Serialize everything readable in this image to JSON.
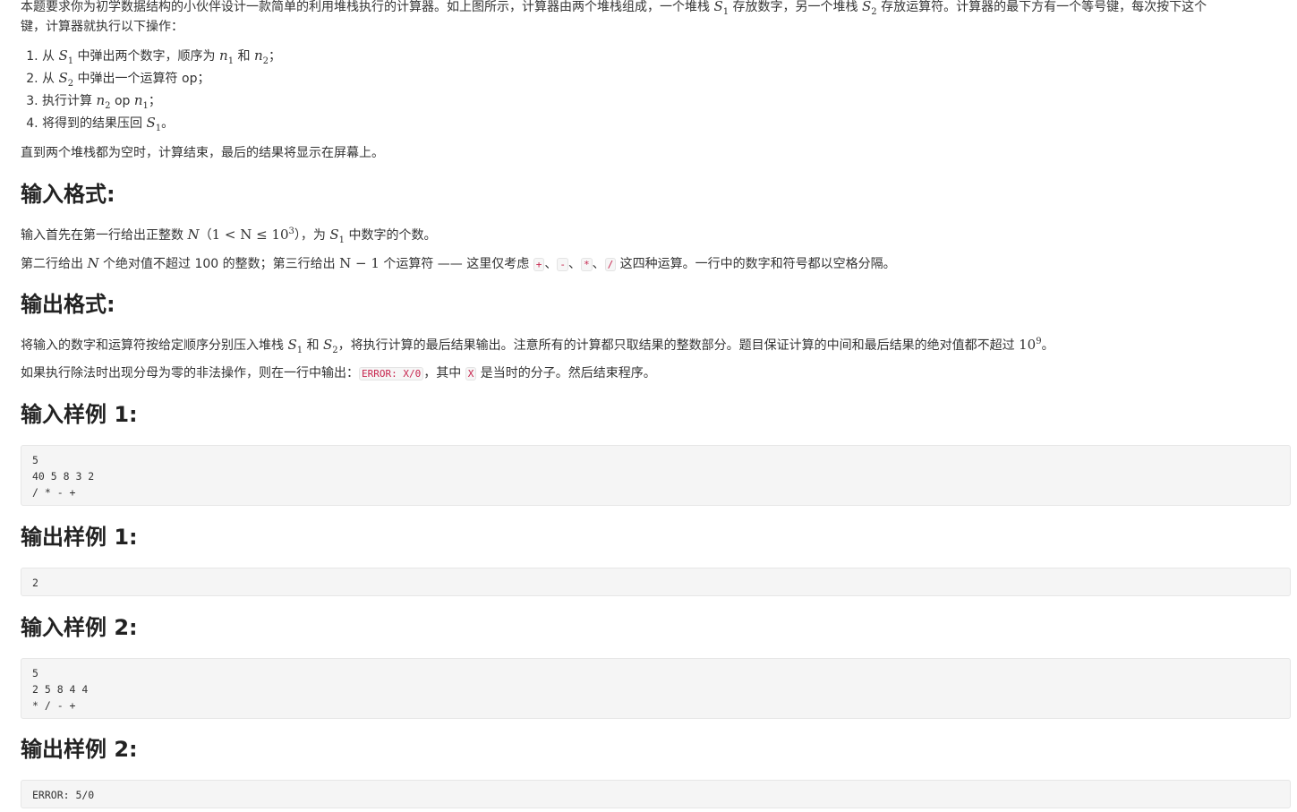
{
  "intro": {
    "p1_a": "本题要求你为初学数据结构的小伙伴设计一款简单的利用堆栈执行的计算器。如上图所示，计算器由两个堆栈组成，一个堆栈 ",
    "s": "S",
    "sub1": "1",
    "sub2": "2",
    "p1_b": " 存放数字，另一个堆栈 ",
    "p1_c": " 存放运算符。计算器的最下方有一个等号键，每次按下这个",
    "p1_d": "键，计算器就执行以下操作：",
    "steps": [
      {
        "a": "从 ",
        "b": " 中弹出两个数字，顺序为 ",
        "c": " 和 ",
        "d": "；"
      },
      {
        "a": "从 ",
        "b": " 中弹出一个运算符 op；"
      },
      {
        "a": "执行计算 ",
        "b": " op ",
        "c": "；"
      },
      {
        "a": "将得到的结果压回 ",
        "b": "。"
      }
    ],
    "n": "n",
    "p2": "直到两个堆栈都为空时，计算结束，最后的结果将显示在屏幕上。"
  },
  "input_format": {
    "heading": "输入格式:",
    "l1_a": "输入首先在第一行给出正整数 ",
    "l1_N": "N",
    "l1_paren_open": "（",
    "l1_math": "1 < N ≤ 10",
    "l1_exp": "3",
    "l1_paren_close": "），为 ",
    "l1_b": " 中数字的个数。",
    "l2_a": "第二行给出 ",
    "l2_b": " 个绝对值不超过 100 的整数；第三行给出 ",
    "l2_math": "N − 1",
    "l2_c": " 个运算符 —— 这里仅考虑 ",
    "ops": [
      "+",
      "-",
      "*",
      "/"
    ],
    "sep": "、",
    "l2_d": " 这四种运算。一行中的数字和符号都以空格分隔。"
  },
  "output_format": {
    "heading": "输出格式:",
    "l1_a": "将输入的数字和运算符按给定顺序分别压入堆栈 ",
    "l1_b": " 和 ",
    "l1_c": "，将执行计算的最后结果输出。注意所有的计算都只取结果的整数部分。题目保证计算的中间和最后结果的绝对值都不超过 ",
    "l1_pow": "10",
    "l1_exp": "9",
    "l1_d": "。",
    "l2_a": "如果执行除法时出现分母为零的非法操作，则在一行中输出：",
    "l2_code": "ERROR: X/0",
    "l2_b": "，其中 ",
    "l2_x": "X",
    "l2_c": " 是当时的分子。然后结束程序。"
  },
  "samples": [
    {
      "heading": "输入样例 1:",
      "code": "5\n40 5 8 3 2\n/ * - +"
    },
    {
      "heading": "输出样例 1:",
      "code": "2"
    },
    {
      "heading": "输入样例 2:",
      "code": "5\n2 5 8 4 4\n* / - +"
    },
    {
      "heading": "输出样例 2:",
      "code": "ERROR: 5/0"
    }
  ]
}
